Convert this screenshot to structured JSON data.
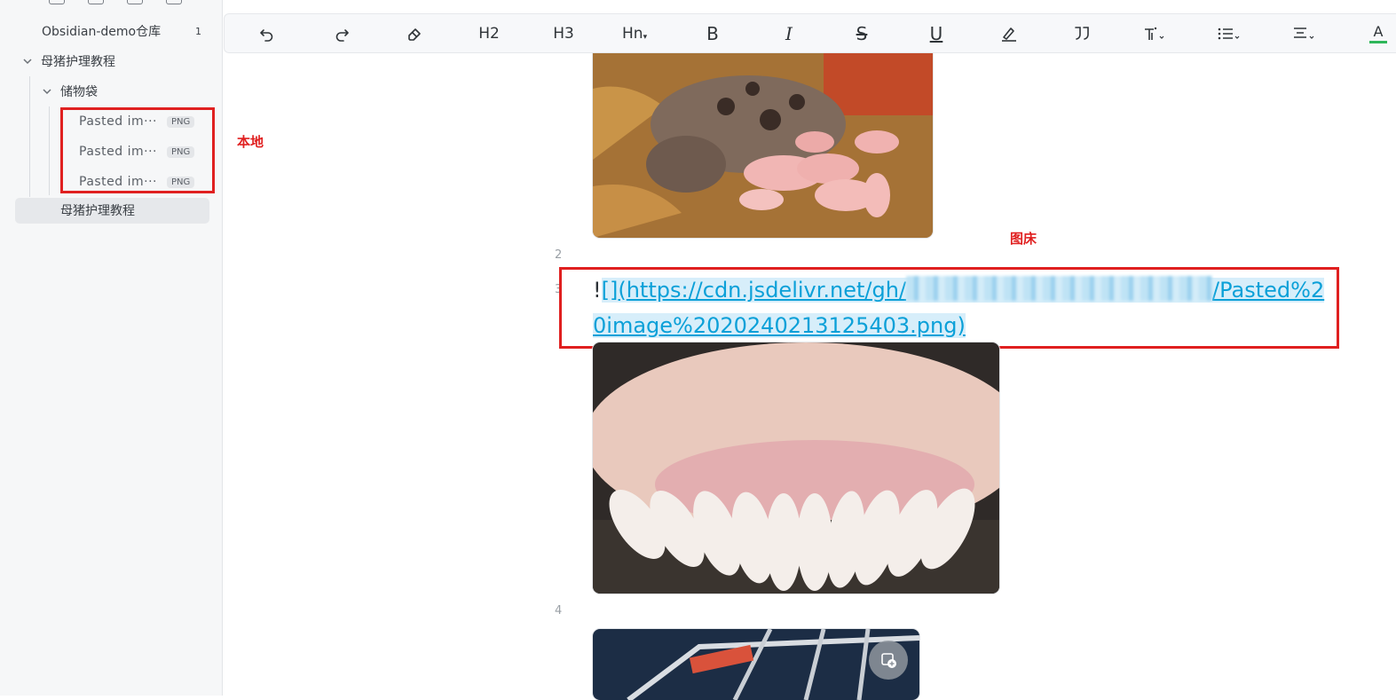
{
  "sidebar": {
    "vault": {
      "name": "Obsidian-demo仓库",
      "count": "1"
    },
    "folder": {
      "name": "母猪护理教程"
    },
    "subfolder": {
      "name": "储物袋"
    },
    "files": [
      {
        "name": "Pasted im···",
        "badge": "PNG"
      },
      {
        "name": "Pasted im···",
        "badge": "PNG"
      },
      {
        "name": "Pasted im···",
        "badge": "PNG"
      }
    ],
    "note": {
      "name": "母猪护理教程"
    }
  },
  "annotations": {
    "local": "本地",
    "imagehost": "图床"
  },
  "toolbar": {
    "h2": "H2",
    "h3": "H3",
    "hn": "Hn",
    "bold": "B",
    "italic": "I",
    "strike": "S",
    "underline": "U",
    "font_color": "A",
    "icons": [
      "undo-icon",
      "redo-icon",
      "eraser-icon",
      "h2-icon",
      "h3-icon",
      "heading-dropdown-icon",
      "bold-icon",
      "italic-icon",
      "strikethrough-icon",
      "underline-icon",
      "highlight-icon",
      "quote-icon",
      "text-style-icon",
      "list-icon",
      "align-icon",
      "font-color-icon"
    ]
  },
  "editor": {
    "line2": "2",
    "line3": "3",
    "line4": "4",
    "link_prefix": "![](",
    "link_visible_start": "https://cdn.jsdelivr.net/gh/",
    "link_visible_end": "/Pasted%2",
    "link_line2": "0image%2020240213125403.png)"
  },
  "colors": {
    "annotation_red": "#e02020",
    "link_blue": "#0ba0d8",
    "accent_green": "#2fb65a"
  }
}
